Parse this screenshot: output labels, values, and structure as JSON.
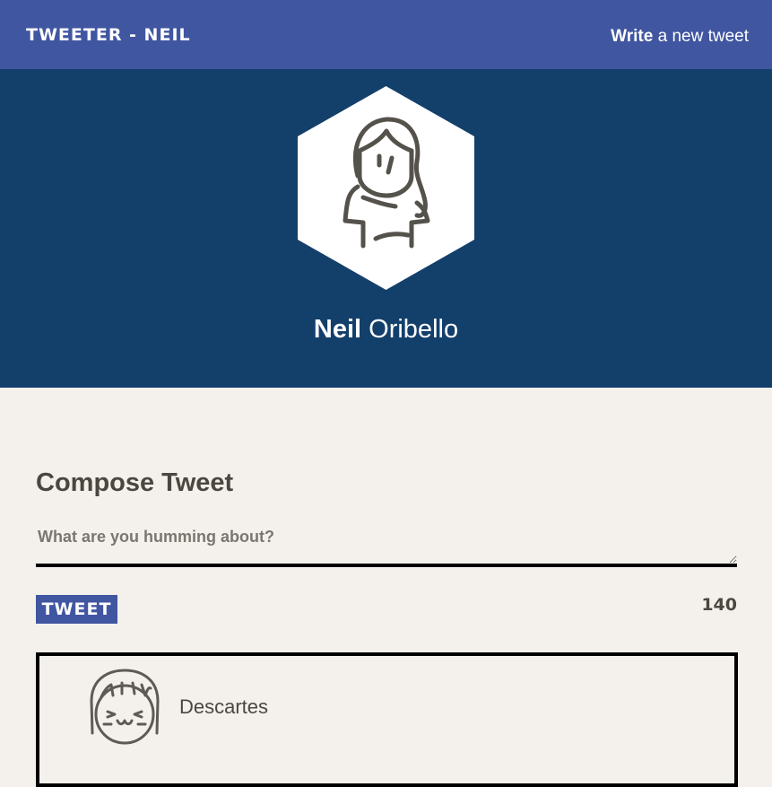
{
  "nav": {
    "brand": "TWEETER - NEIL",
    "write_strong": "Write",
    "write_rest": " a new tweet"
  },
  "profile": {
    "first_name": "Neil",
    "last_name": " Oribello",
    "avatar_icon": "female-avatar-icon"
  },
  "compose": {
    "title": "Compose Tweet",
    "placeholder": "What are you humming about?",
    "value": "",
    "button_label": "TWEET",
    "counter": "140"
  },
  "tweets": [
    {
      "author": "Descartes",
      "avatar_icon": "smiling-avatar-icon"
    }
  ],
  "colors": {
    "nav": "#4156a1",
    "hero": "#133f6b",
    "page": "#f4f1ec",
    "text": "#4a4740"
  }
}
